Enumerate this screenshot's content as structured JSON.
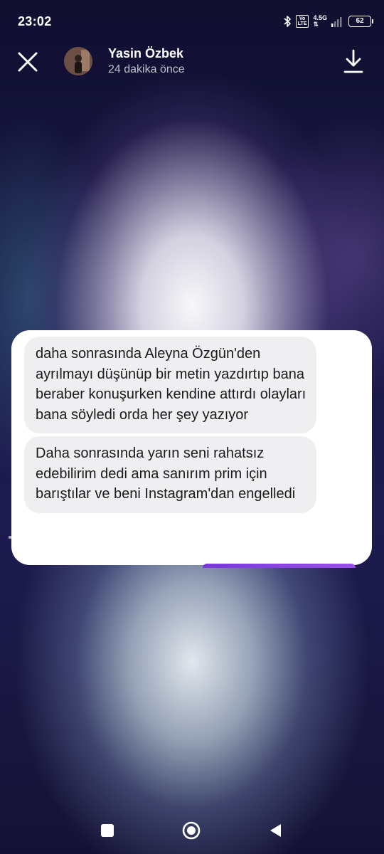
{
  "status_bar": {
    "time": "23:02",
    "volte_top": "Vo",
    "volte_bottom": "LTE",
    "network_type": "4.5G",
    "battery_level": "62",
    "icons": [
      "bluetooth-icon",
      "volte-icon",
      "signal-icon",
      "battery-icon"
    ]
  },
  "header": {
    "username": "Yasin Özbek",
    "time_ago": "24 dakika önce",
    "icons": [
      "close-icon",
      "download-icon"
    ]
  },
  "messages": [
    {
      "text": " daha sonrasında Aleyna Özgün'den ayrılmayı düşünüp bir metin yazdırtıp bana beraber konuşurken kendine attırdı olayları bana söyledi orda her şey yazıyor"
    },
    {
      "text": "Daha sonrasında yarın seni rahatsız edebilirim dedi ama sanırım prim için barıştılar ve beni Instagram'dan engelledi"
    }
  ],
  "nav_bar": {
    "icons": [
      "recents-icon",
      "home-icon",
      "back-icon"
    ]
  },
  "colors": {
    "accent_purple": "#8a44e0",
    "bubble_bg": "#efeff1",
    "card_bg": "#ffffff"
  }
}
